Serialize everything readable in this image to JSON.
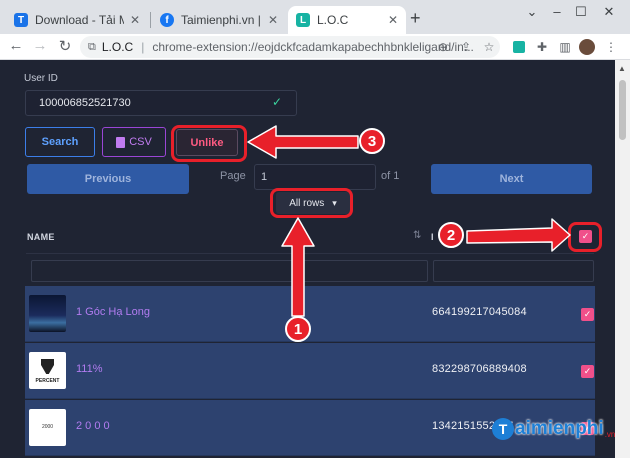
{
  "browser": {
    "tabs": [
      {
        "title": "Download - Tải Miễn Phí",
        "favicon": "T"
      },
      {
        "title": "Taimienphi.vn | Faceboo",
        "favicon": "f"
      },
      {
        "title": "L.O.C",
        "favicon": "L"
      }
    ],
    "new_tab": "+",
    "window_controls": [
      "chevron-down-icon",
      "minimize-icon",
      "maximize-icon",
      "close-icon"
    ],
    "address": {
      "site_name": "L.O.C",
      "url": "chrome-extension://eojdckfcadamkapabechhbnkleligand/in..."
    }
  },
  "page": {
    "user_id_label": "User ID",
    "user_id_value": "100006852521730",
    "buttons": {
      "search": "Search",
      "csv": "CSV",
      "unlike": "Unlike"
    },
    "pagination": {
      "previous": "Previous",
      "next": "Next",
      "page_label": "Page",
      "page_value": "1",
      "of_label": "of 1"
    },
    "rows_select": "All rows",
    "table": {
      "col_name": "NAME",
      "col_id": "I",
      "rows": [
        {
          "name": "1 Góc Hạ Long",
          "id": "664199217045084",
          "checked": true
        },
        {
          "name": "111%",
          "id": "832298706889408",
          "checked": true,
          "logo_text": "PERCENT"
        },
        {
          "name": "2 0 0 0",
          "id": "1342151552654",
          "checked": true,
          "logo_text": "2000"
        }
      ]
    }
  },
  "annotations": {
    "badge_1": "1",
    "badge_2": "2",
    "badge_3": "3",
    "color": "#e8202a"
  },
  "watermark": {
    "letter": "T",
    "text": "aimienphi",
    "suffix": ".vn"
  }
}
